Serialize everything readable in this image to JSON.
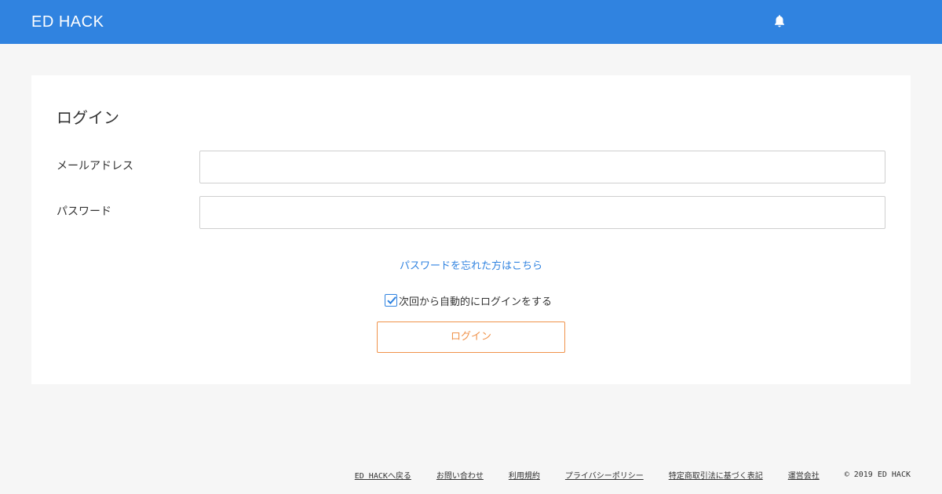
{
  "header": {
    "logo_text": "ED HACK",
    "notification_icon": "bell-icon",
    "background_color": "#3083e0"
  },
  "login_card": {
    "title": "ログイン",
    "email_label": "メールアドレス",
    "email_value": "",
    "password_label": "パスワード",
    "password_value": "",
    "forgot_password_link": "パスワードを忘れた方はこちら",
    "remember_me_label": "次回から自動的にログインをする",
    "remember_me_checked": true,
    "login_button_label": "ログイン",
    "login_button_color": "#f0924a"
  },
  "footer": {
    "links": [
      "ED HACKへ戻る",
      "お問い合わせ",
      "利用規約",
      "プライバシーポリシー",
      "特定商取引法に基づく表記",
      "運営会社"
    ],
    "copyright": "© 2019 ED HACK"
  }
}
